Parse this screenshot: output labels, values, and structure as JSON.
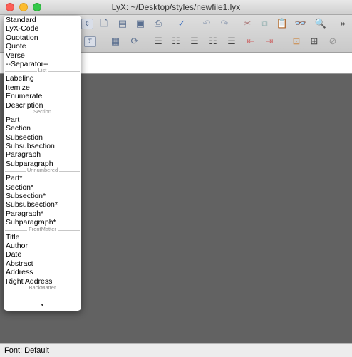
{
  "window": {
    "title": "LyX: ~/Desktop/styles/newfile1.lyx"
  },
  "status": {
    "text": "Font: Default"
  },
  "layout_menu": {
    "groups": [
      {
        "label": "",
        "items": [
          "Standard",
          "LyX-Code",
          "Quotation",
          "Quote",
          "Verse",
          "--Separator--"
        ]
      },
      {
        "label": "List",
        "items": [
          "Labeling",
          "Itemize",
          "Enumerate",
          "Description"
        ]
      },
      {
        "label": "Section",
        "items": [
          "Part",
          "Section",
          "Subsection",
          "Subsubsection",
          "Paragraph",
          "Subparagraph"
        ]
      },
      {
        "label": "Unnumbered",
        "items": [
          "Part*",
          "Section*",
          "Subsection*",
          "Subsubsection*",
          "Paragraph*",
          "Subparagraph*"
        ]
      },
      {
        "label": "FrontMatter",
        "items": [
          "Title",
          "Author",
          "Date",
          "Abstract",
          "Address",
          "Right Address"
        ]
      },
      {
        "label": "BackMatter",
        "items": []
      }
    ]
  },
  "toolbar": {
    "row1": [
      "layout-dropdown-arrow-icon",
      "new-file-icon",
      "open-icon",
      "save-icon",
      "print-icon",
      "spellcheck-icon",
      "undo-icon",
      "redo-icon",
      "cut-icon",
      "copy-icon",
      "paste-icon",
      "find-icon"
    ],
    "row2": [
      "math-icon",
      "table-icon",
      "list-icon",
      "enumerate-icon",
      "description-icon",
      "outline-icon",
      "depth-decrease-icon",
      "depth-increase-icon",
      "float-figure-icon",
      "float-table-icon",
      "tag-icon"
    ]
  },
  "colors": {
    "canvas": "#626262",
    "close": "#fc5f57",
    "minimize": "#fdbc2e",
    "maximize": "#34c84a"
  }
}
